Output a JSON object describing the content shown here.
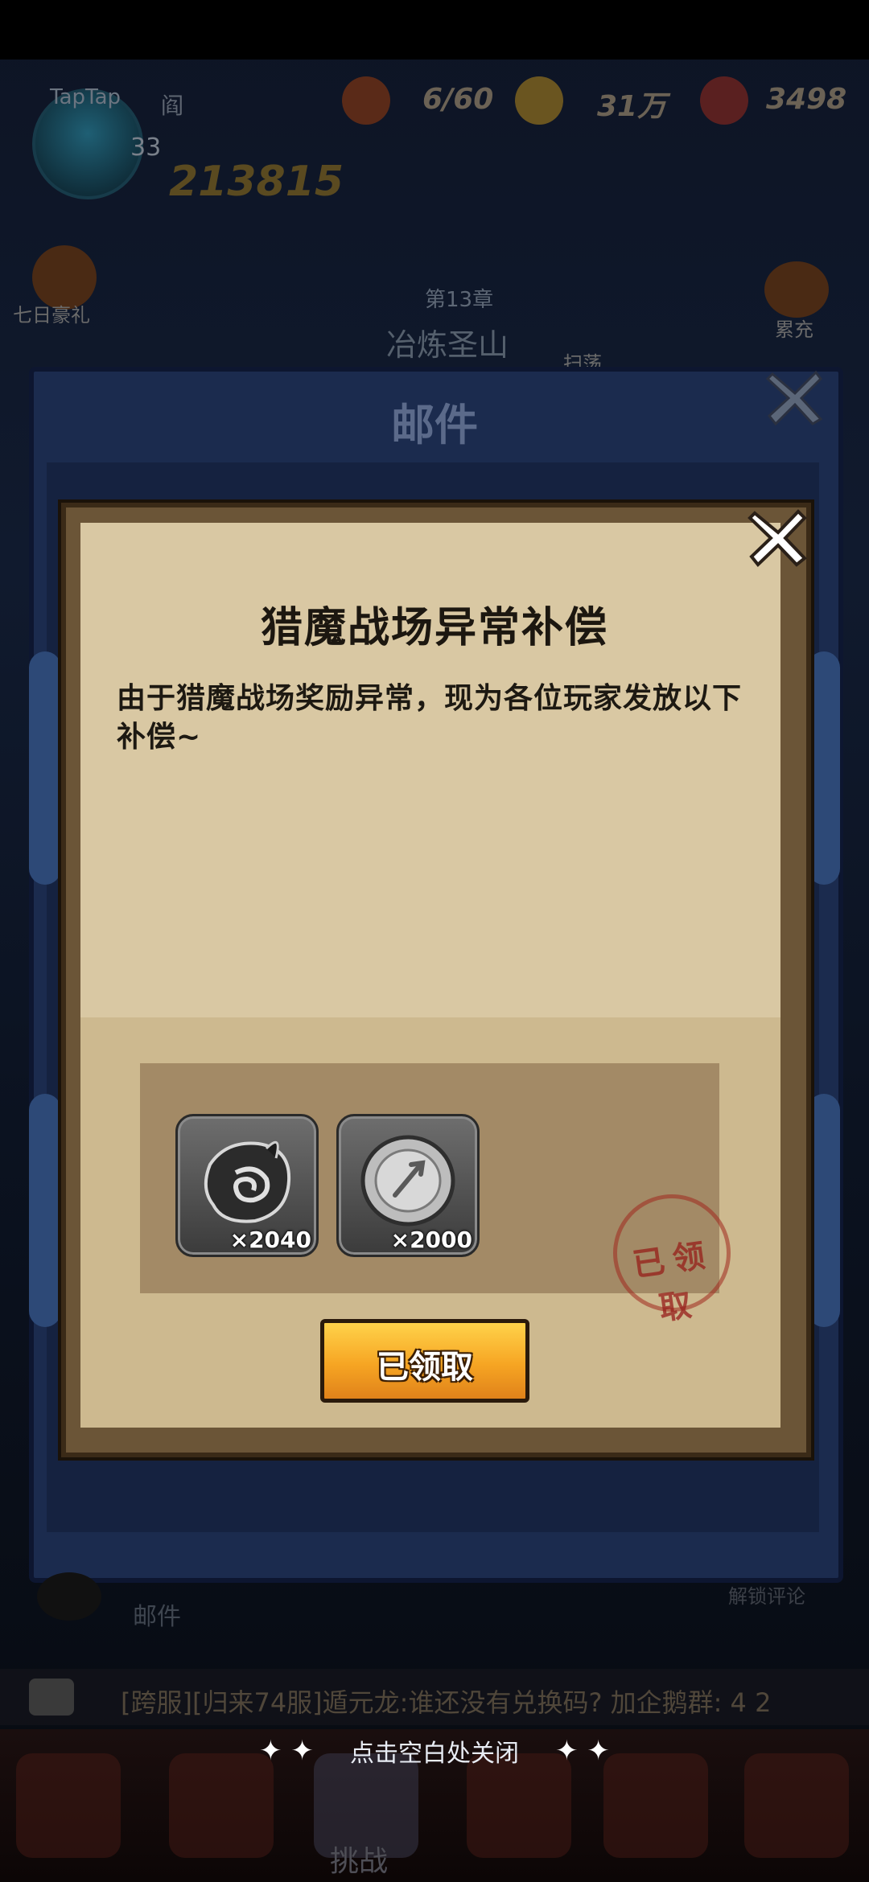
{
  "hud": {
    "taptap_label": "TapTap",
    "player_name": "阎",
    "level": "33",
    "power": "213815",
    "stamina": "6/60",
    "gold": "31万",
    "gems": "3498",
    "seven_day_gift": "七日豪礼",
    "chapter": "第13章",
    "chapter_name": "冶炼圣山",
    "sweep_label": "扫荡",
    "recharge_label": "累充"
  },
  "mail_panel": {
    "title": "邮件",
    "mail_label": "邮件",
    "unlock_hint": "解锁评论"
  },
  "mail_detail": {
    "title": "猎魔战场异常补偿",
    "body": "由于猎魔战场奖励异常，现为各位玩家发放以下补偿~",
    "rewards": [
      {
        "icon": "beast-soul-icon",
        "quantity": "×2040"
      },
      {
        "icon": "silver-coin-icon",
        "quantity": "×2000"
      }
    ],
    "stamp_text": "已领取",
    "claim_button_label": "已领取"
  },
  "chat": {
    "text": "[跨服][归来74服]遁元龙:谁还没有兑换码? 加企鹅群: 4 2"
  },
  "bottom_nav": {
    "active_tab_label": "挑战"
  },
  "close_hint": "点击空白处关闭",
  "colors": {
    "parchment": "#d9c8a3",
    "button_orange": "#f6a523",
    "stamp_red": "#a0281e",
    "panel_blue": "#1b2b4e"
  }
}
